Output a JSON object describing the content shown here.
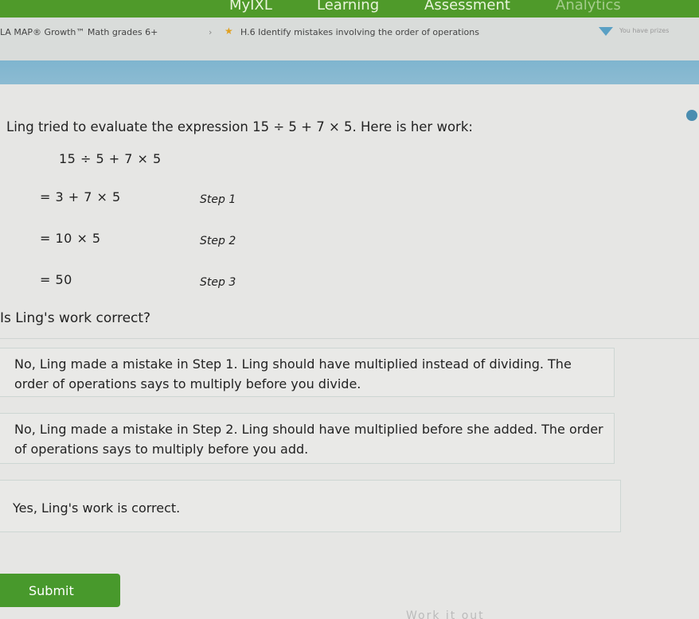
{
  "nav": {
    "items": [
      "MyIXL",
      "Learning",
      "Assessment",
      "Analytics"
    ]
  },
  "breadcrumb": {
    "grade": "LA MAP® Growth™ Math grades 6+",
    "skill": "H.6 Identify mistakes involving the order of operations",
    "prize": "You have prizes"
  },
  "question": {
    "prompt_before": "Ling tried to evaluate the expression ",
    "expression": "15 ÷ 5 + 7 × 5",
    "prompt_after": ". Here is her work:",
    "work_start": "15 ÷ 5 + 7 × 5",
    "steps": [
      {
        "expr": "= 3 + 7 × 5",
        "label": "Step 1"
      },
      {
        "expr": "= 10 × 5",
        "label": "Step 2"
      },
      {
        "expr": "= 50",
        "label": "Step 3"
      }
    ],
    "ask": "Is Ling's work correct?"
  },
  "choices": [
    "No, Ling made a mistake in Step 1. Ling should have multiplied instead of dividing. The order of operations says to multiply before you divide.",
    "No, Ling made a mistake in Step 2. Ling should have multiplied before she added. The order of operations says to multiply before you add.",
    "Yes, Ling's work is correct."
  ],
  "submit_label": "Submit",
  "footer_text": "Work it out",
  "colors": {
    "nav": "#4f9a2a",
    "strip": "#7fb5cf",
    "submit": "#48992c"
  }
}
